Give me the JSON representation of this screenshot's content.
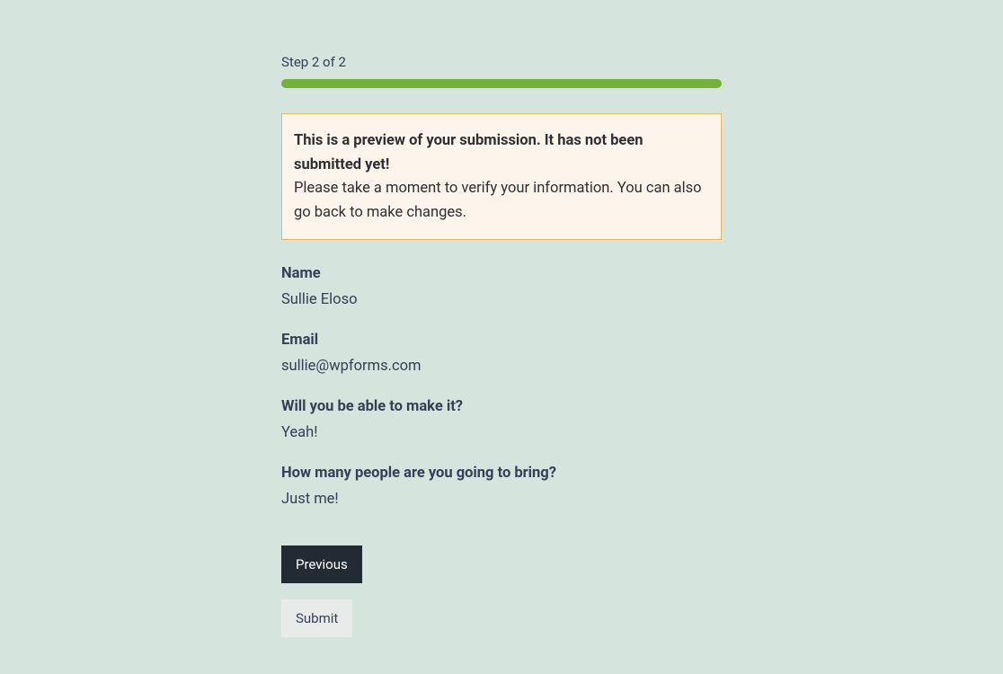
{
  "step_indicator": "Step 2 of 2",
  "notice": {
    "title": "This is a preview of your submission. It has not been submitted yet!",
    "text": "Please take a moment to verify your information. You can also go back to make changes."
  },
  "fields": [
    {
      "label": "Name",
      "value": "Sullie Eloso"
    },
    {
      "label": "Email",
      "value": "sullie@wpforms.com"
    },
    {
      "label": "Will you be able to make it?",
      "value": "Yeah!"
    },
    {
      "label": "How many people are you going to bring?",
      "value": "Just me!"
    }
  ],
  "buttons": {
    "previous": "Previous",
    "submit": "Submit"
  }
}
